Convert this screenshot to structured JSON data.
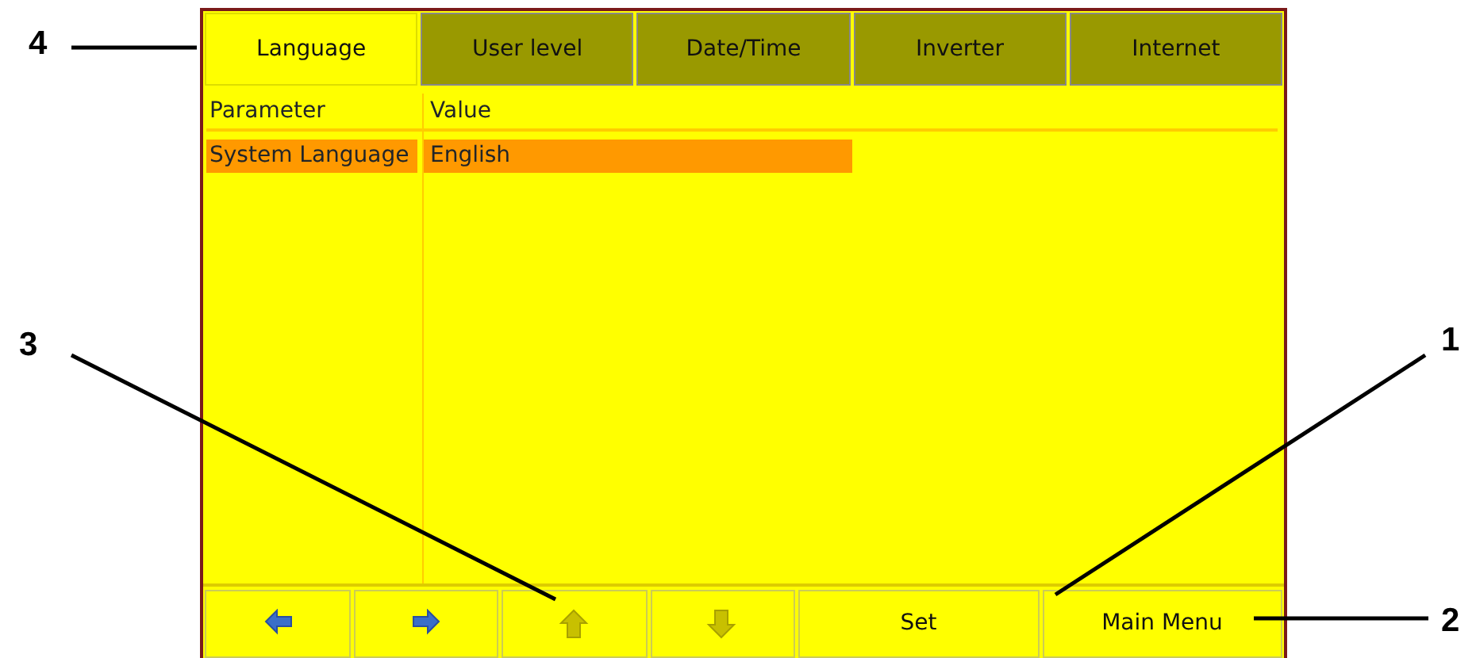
{
  "tabs": [
    {
      "label": "Language",
      "selected": true
    },
    {
      "label": "User level",
      "selected": false
    },
    {
      "label": "Date/Time",
      "selected": false
    },
    {
      "label": "Inverter",
      "selected": false
    },
    {
      "label": "Internet",
      "selected": false
    }
  ],
  "table": {
    "columns": [
      "Parameter",
      "Value"
    ],
    "rows": [
      {
        "cells": [
          "System Language",
          "English"
        ],
        "selected": true
      }
    ]
  },
  "buttons": [
    {
      "kind": "left",
      "disabled": false
    },
    {
      "kind": "right",
      "disabled": false
    },
    {
      "kind": "up",
      "disabled": true
    },
    {
      "kind": "down",
      "disabled": true
    },
    {
      "kind": "text",
      "label": "Set",
      "disabled": false
    },
    {
      "kind": "text",
      "label": "Main Menu",
      "disabled": false
    }
  ],
  "callouts": [
    {
      "label": "4",
      "kind": "tabs"
    },
    {
      "label": "3",
      "kind": "arrows"
    },
    {
      "label": "1",
      "kind": "set"
    },
    {
      "label": "2",
      "kind": "menu"
    }
  ]
}
